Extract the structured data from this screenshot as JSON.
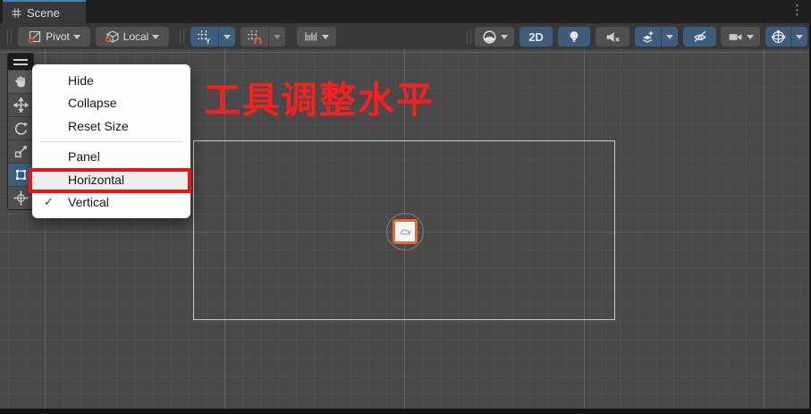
{
  "tab": {
    "title": "Scene"
  },
  "toolbar": {
    "pivot_label": "Pivot",
    "local_label": "Local",
    "two_d_label": "2D"
  },
  "icons": {
    "kebab_glyph": "⋮",
    "grid_axis_label": "Y",
    "check_glyph": "✓"
  },
  "menu": {
    "items": [
      {
        "label": "Hide"
      },
      {
        "label": "Collapse"
      },
      {
        "label": "Reset Size"
      },
      {
        "label": "Panel"
      },
      {
        "label": "Horizontal",
        "highlighted": true,
        "annotated": true
      },
      {
        "label": "Vertical",
        "checked": true
      }
    ]
  },
  "annotation": {
    "text": "工具调整水平",
    "color": "#f52020",
    "box_color": "#e41717"
  },
  "colors": {
    "tab_accent_blue": "#4a79b6",
    "active_button_blue": "#3e5c7c",
    "selection_orange": "#e8662f",
    "scene_background": "#494949"
  }
}
